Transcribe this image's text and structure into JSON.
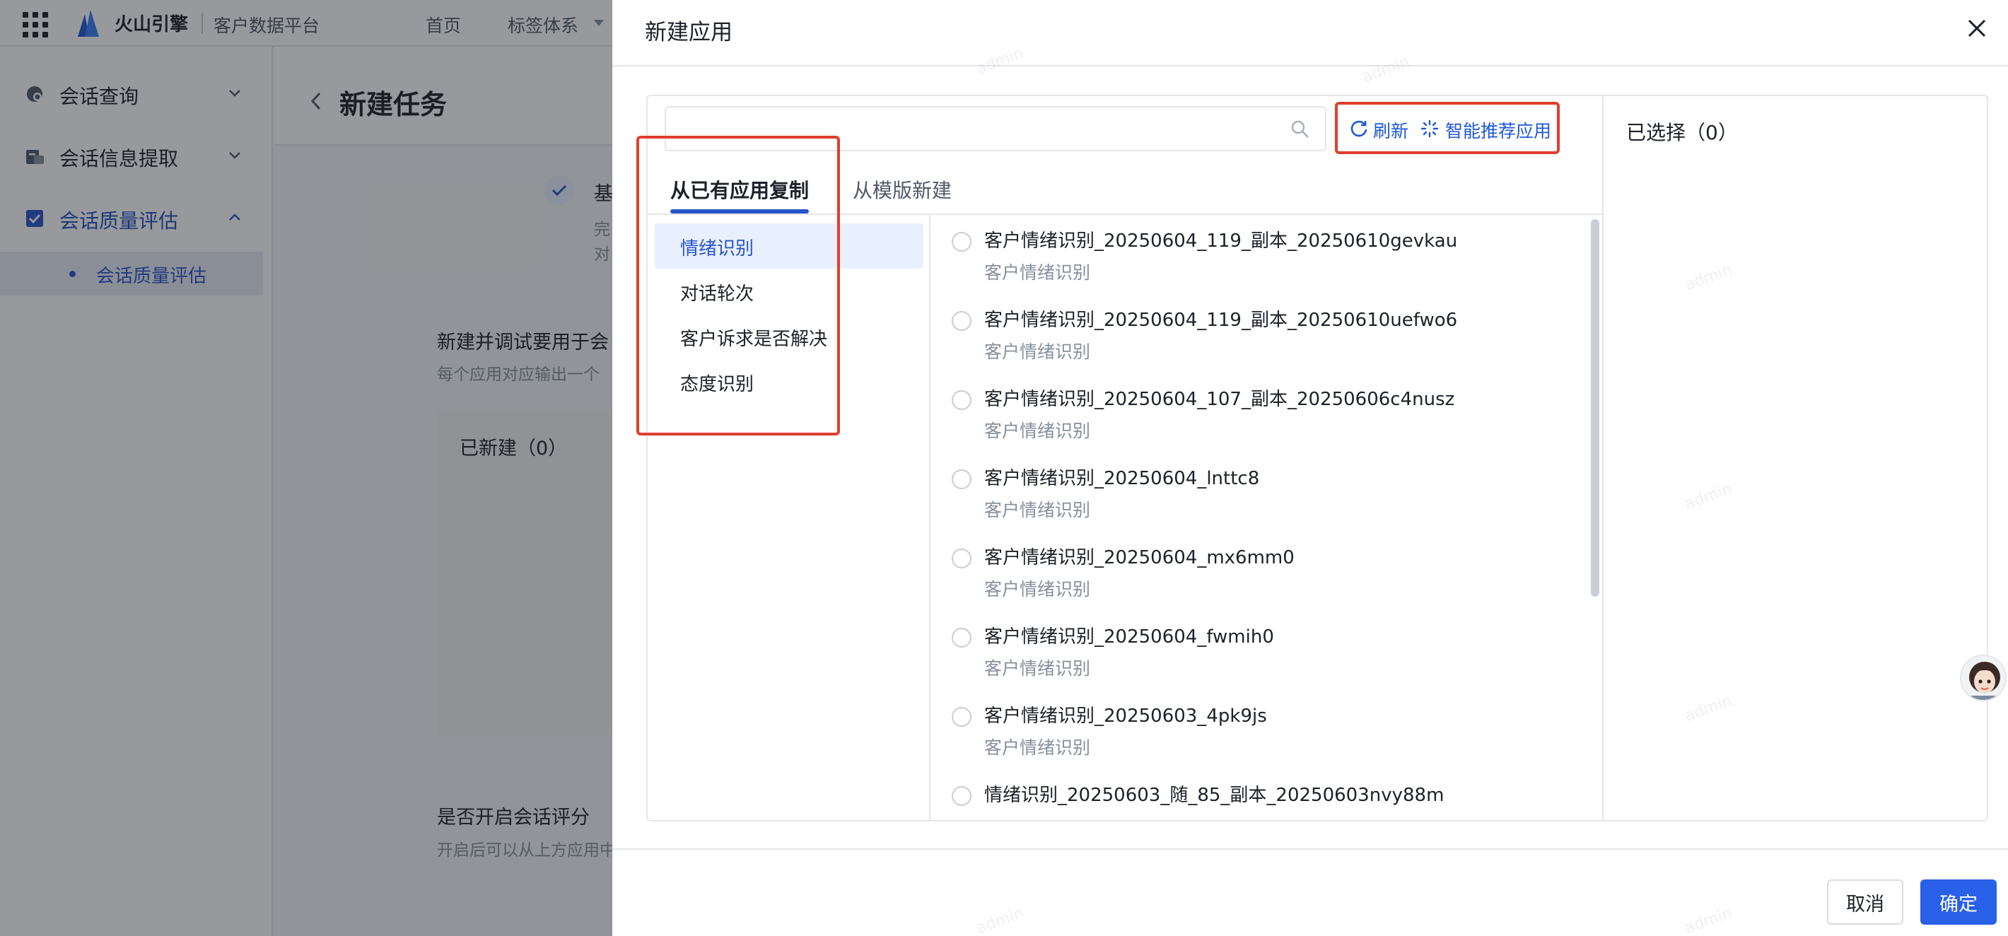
{
  "app": {
    "brand": "火山引擎",
    "sub_brand": "客户数据平台",
    "nav": [
      "首页",
      "标签体系"
    ]
  },
  "sidebar": {
    "items": [
      {
        "label": "会话查询",
        "icon": "chat-search-icon",
        "expanded": false
      },
      {
        "label": "会话信息提取",
        "icon": "info-extract-icon",
        "expanded": false
      },
      {
        "label": "会话质量评估",
        "icon": "quality-check-icon",
        "expanded": true,
        "active": true
      }
    ],
    "sub_items": [
      {
        "label": "会话质量评估",
        "active": true
      }
    ]
  },
  "page": {
    "title": "新建任务",
    "step_title": "基",
    "step_desc": [
      "完",
      "对"
    ],
    "section_title": "新建并调试要用于会",
    "section_desc": "每个应用对应输出一个",
    "created_title": "已新建（0）",
    "score_title": "是否开启会话评分",
    "score_desc": "开启后可以从上方应用中"
  },
  "drawer": {
    "title": "新建应用",
    "search": {
      "value": "",
      "placeholder": ""
    },
    "refresh_label": "刷新",
    "recommend_label": "智能推荐应用",
    "selected_title": "已选择（0）",
    "tabs": [
      {
        "label": "从已有应用复制",
        "active": true
      },
      {
        "label": "从模版新建",
        "active": false
      }
    ],
    "categories": [
      {
        "label": "情绪识别",
        "active": true
      },
      {
        "label": "对话轮次",
        "active": false
      },
      {
        "label": "客户诉求是否解决",
        "active": false
      },
      {
        "label": "态度识别",
        "active": false
      }
    ],
    "apps": [
      {
        "name": "客户情绪识别_20250604_119_副本_20250610gevkau",
        "category": "客户情绪识别"
      },
      {
        "name": "客户情绪识别_20250604_119_副本_20250610uefwo6",
        "category": "客户情绪识别"
      },
      {
        "name": "客户情绪识别_20250604_107_副本_20250606c4nusz",
        "category": "客户情绪识别"
      },
      {
        "name": "客户情绪识别_20250604_lnttc8",
        "category": "客户情绪识别"
      },
      {
        "name": "客户情绪识别_20250604_mx6mm0",
        "category": "客户情绪识别"
      },
      {
        "name": "客户情绪识别_20250604_fwmih0",
        "category": "客户情绪识别"
      },
      {
        "name": "客户情绪识别_20250603_4pk9js",
        "category": "客户情绪识别"
      },
      {
        "name": "情绪识别_20250603_随_85_副本_20250603nvy88m",
        "category": ""
      }
    ],
    "cancel_label": "取消",
    "ok_label": "确定"
  },
  "watermark": "admin",
  "colors": {
    "primary": "#2860e8",
    "link": "#1f58d6",
    "highlight_border": "#e03e2d",
    "overlay": "rgba(25,28,35,0.45)"
  }
}
